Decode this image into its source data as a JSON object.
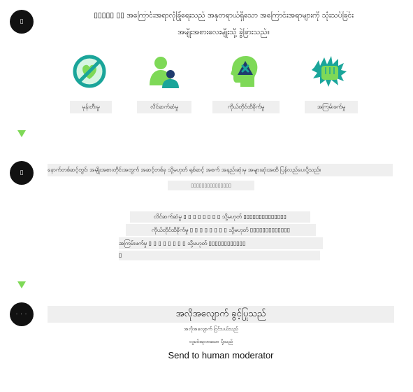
{
  "colors": {
    "accent_green": "#7ed957",
    "dark_blue": "#1f3b6e",
    "teal": "#1aa59a",
    "light_grey": "#efefef",
    "dot": "#111111"
  },
  "steps": [
    {
      "marker": "▯",
      "heading_line1": "▯▯▯▯▯ ▯▯ အကြောင်းအရာလုံခြုံရေးသည် အနုတရာယ်ရှိသော အကြောင်းအရာများကို သုံးသပ်ခြင်း",
      "heading_line2": "အမျိုးအစားလေးမျိုးသို့ ခွဲခြားသည်။",
      "categories": [
        {
          "label": "မုန်းတီးမှု",
          "icon": "hate-icon"
        },
        {
          "label": "လိင်ဆက်ဆံမှု",
          "icon": "sexual-icon"
        },
        {
          "label": "ကိုယ်တိုင်ထိခိုက်မှု",
          "icon": "self-harm-icon"
        },
        {
          "label": "အကြမ်းဖက်မှု",
          "icon": "violence-icon"
        }
      ]
    },
    {
      "marker": "▯",
      "text_line1": "နောက်တစ်ဆင့်တွင်၊ အမျိုးအစားတိုင်းအတွက် အဆင့်တစ်ခု သို့မဟုတ် ရုစ်ဆင့် အစက် အနည်းဆုံးမှ အများဆုံးအထိ ပြန်လည်ပေးပို့သည်။",
      "text_line2": "▯▯▯▯▯▯▯▯▯▯▯▯▯▯▯",
      "severity_rows": [
        "လိင်ဆက်ဆံမှု ▯ ▯ ▯ ▯ ▯ ▯ ▯ ▯ သို့မဟုတ် ▯▯▯▯▯▯▯▯▯▯▯▯▯▯",
        "ကိုယ်တိုင်ထိခိုက်မှု ▯ ▯ ▯ ▯ ▯ ▯ ▯ ▯ သို့မဟုတ် ▯▯▯▯▯▯▯▯▯▯▯▯▯",
        "အကြမ်းဖက်မှု ▯ ▯ ▯ ▯ ▯ ▯ ▯ ▯ သို့မဟုတ် ▯▯▯▯▯▯▯▯▯▯▯▯",
        "▯"
      ]
    },
    {
      "marker": "· · ·",
      "title": "အလိုအလျောက် ခွင့်ပြုသည်",
      "sub1": "အလိုအလျောက် ငြင်းပယ်သည်",
      "sub2": "လူမင်းရလာသော ပို့သည်",
      "english": "Send to human moderator"
    }
  ]
}
